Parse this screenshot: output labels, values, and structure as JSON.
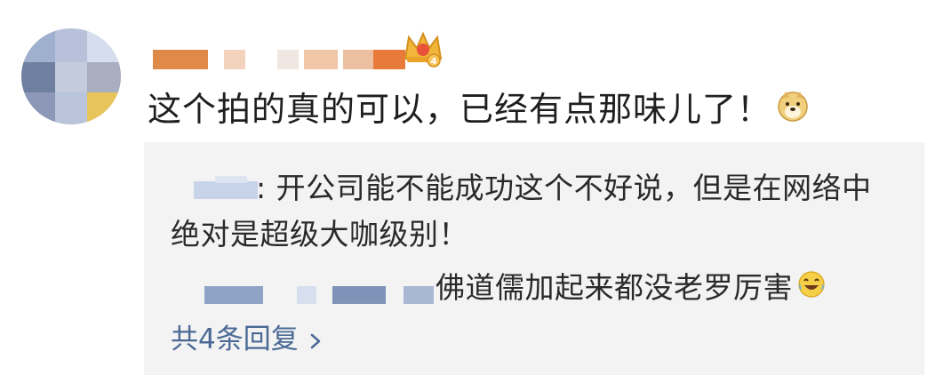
{
  "comment": {
    "text": "这个拍的真的可以，已经有点那味儿了！",
    "emoji_icon": "doge-icon"
  },
  "replies": [
    {
      "separator": ":",
      "line1": " 开公司能不能成功这个不好说，但是在网络中",
      "line2": "绝对是超级大咖级别！"
    },
    {
      "text": "佛道儒加起来都没老罗厉害",
      "emoji_icon": "laughing-tears-icon"
    }
  ],
  "more_replies": {
    "label": "共4条回复"
  },
  "colors": {
    "link": "#4a6a95",
    "reply_background": "#f3f3f3",
    "crown_gold": "#f2b63a"
  }
}
